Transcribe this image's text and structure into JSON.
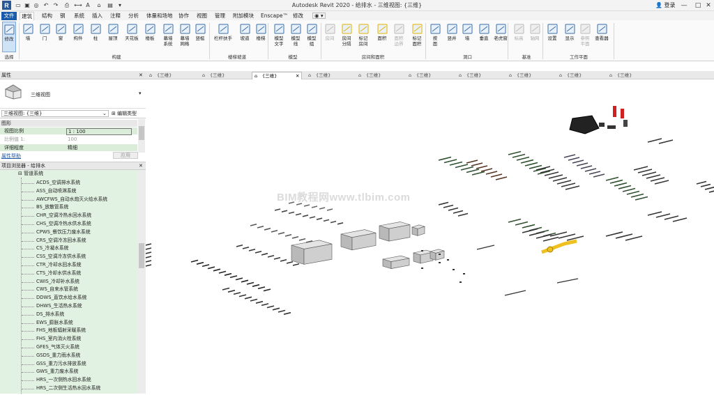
{
  "app": {
    "window_title": "Autodesk Revit 2020 - 给排水 - 三维视图: {三维}",
    "signin_label": "登录"
  },
  "menu": {
    "tabs": [
      "文件",
      "建筑",
      "结构",
      "钢",
      "系统",
      "插入",
      "注释",
      "分析",
      "体量和场地",
      "协作",
      "视图",
      "管理",
      "附加模块",
      "Enscape™",
      "修改"
    ],
    "active_index": 1
  },
  "ribbon": {
    "buttons": [
      {
        "label": "修改",
        "icon": "cursor-icon",
        "selected": true
      },
      {
        "label": "墙",
        "icon": "wall-icon"
      },
      {
        "label": "门",
        "icon": "door-icon"
      },
      {
        "label": "窗",
        "icon": "window-icon"
      },
      {
        "label": "构件",
        "icon": "component-icon"
      },
      {
        "label": "柱",
        "icon": "column-icon"
      },
      {
        "label": "屋顶",
        "icon": "roof-icon"
      },
      {
        "label": "天花板",
        "icon": "ceiling-icon"
      },
      {
        "label": "楼板",
        "icon": "floor-icon"
      },
      {
        "label": "幕墙\n系统",
        "icon": "curtain-system-icon"
      },
      {
        "label": "幕墙\n网格",
        "icon": "curtain-grid-icon"
      },
      {
        "label": "竖梃",
        "icon": "mullion-icon"
      },
      {
        "label": "栏杆扶手",
        "icon": "railing-icon"
      },
      {
        "label": "坡道",
        "icon": "ramp-icon"
      },
      {
        "label": "楼梯",
        "icon": "stair-icon"
      },
      {
        "label": "模型\n文字",
        "icon": "model-text-icon"
      },
      {
        "label": "模型\n线",
        "icon": "model-line-icon"
      },
      {
        "label": "模型\n组",
        "icon": "model-group-icon"
      },
      {
        "label": "房间",
        "icon": "room-icon",
        "dim": true
      },
      {
        "label": "房间\n分隔",
        "icon": "room-separator-icon"
      },
      {
        "label": "标记\n房间",
        "icon": "tag-room-icon"
      },
      {
        "label": "面积",
        "icon": "area-icon"
      },
      {
        "label": "面积\n边界",
        "icon": "area-boundary-icon",
        "dim": true
      },
      {
        "label": "标记\n面积",
        "icon": "tag-area-icon"
      },
      {
        "label": "按\n面",
        "icon": "by-face-icon"
      },
      {
        "label": "竖井",
        "icon": "shaft-icon"
      },
      {
        "label": "墙",
        "icon": "wall-opening-icon"
      },
      {
        "label": "垂直",
        "icon": "vertical-opening-icon"
      },
      {
        "label": "老虎窗",
        "icon": "dormer-icon"
      },
      {
        "label": "标高",
        "icon": "level-icon",
        "dim": true
      },
      {
        "label": "轴网",
        "icon": "grid-icon",
        "dim": true
      },
      {
        "label": "设置",
        "icon": "set-workplane-icon"
      },
      {
        "label": "显示",
        "icon": "show-workplane-icon"
      },
      {
        "label": "参照\n平面",
        "icon": "ref-plane-icon",
        "dim": true
      },
      {
        "label": "查看器",
        "icon": "viewer-icon"
      }
    ],
    "panels": [
      "选择",
      "构建",
      "楼梯坡道",
      "模型",
      "房间和面积",
      "洞口",
      "基准",
      "工作平面"
    ]
  },
  "properties": {
    "header": "属性",
    "type_name": "三维视图",
    "instance_selector": "三维视图: {三维}",
    "edit_type_label": "编辑类型",
    "group_label": "图形",
    "rows": [
      {
        "name": "视图比例",
        "value": "1 : 100"
      },
      {
        "name": "比例值 1:",
        "value": "100"
      },
      {
        "name": "详细程度",
        "value": "精细"
      }
    ],
    "help_link": "属性帮助",
    "apply_label": "应用"
  },
  "browser": {
    "header": "项目浏览器 - 给排水",
    "group": "管道系统",
    "items": [
      "ACDS_空调排水系统",
      "ASS_自动喷淋系统",
      "AWCFWS_自动水炮灭火给水系统",
      "BS_放散管系统",
      "CHR_空调冷热水回水系统",
      "CHS_空调冷热水供水系统",
      "CPWS_餐饮压力废水系统",
      "CRS_空调冷冻回水系统",
      "CS_冷凝水系统",
      "CSS_空调冷冻供水系统",
      "CTR_冷却水回水系统",
      "CTS_冷却水供水系统",
      "CWIS_冷却补水系统",
      "CWS_自来水管系统",
      "DDWS_直饮水给水系统",
      "DHWS_生活热水系统",
      "DS_排水系统",
      "EWS_膨胀水系统",
      "FHS_地板辐射采暖系统",
      "FHS_室内消火栓系统",
      "GFES_气体灭火系统",
      "GSDS_重力雨水系统",
      "GSS_重力污水排放系统",
      "GWS_重力废水系统",
      "HRS_一次侧热水回水系统",
      "HRS_二次侧生活热水回水系统"
    ]
  },
  "view_tabs": [
    {
      "label": "{三维}",
      "active": false
    },
    {
      "label": "{三维}",
      "active": false
    },
    {
      "label": "{三维}",
      "active": true
    },
    {
      "label": "{三维}",
      "active": false
    },
    {
      "label": "{三维}",
      "active": false
    },
    {
      "label": "{三维}",
      "active": false
    },
    {
      "label": "{三维}",
      "active": false
    },
    {
      "label": "{三维}",
      "active": false
    },
    {
      "label": "{三维}",
      "active": false
    },
    {
      "label": "{三维}",
      "active": false
    }
  ],
  "canvas": {
    "watermark": "BIM教程网www.tlbim.com"
  },
  "colors": {
    "file_tab": "#1a5aa8",
    "browser_bg": "#e2f2e2",
    "selected_button": "#cfe3f7",
    "equipment_grey": "#d8d8d8",
    "accent_yellow": "#f0c020",
    "accent_red": "#d02020"
  }
}
